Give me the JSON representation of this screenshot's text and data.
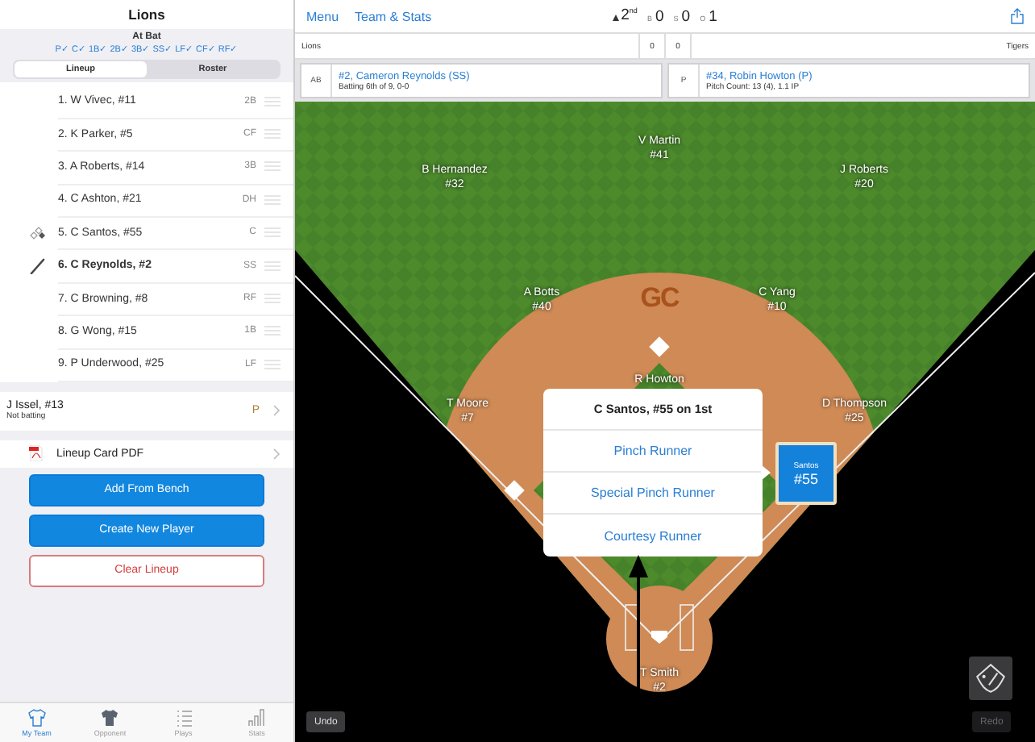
{
  "sidebar": {
    "title": "Lions",
    "at_bat": {
      "heading": "At Bat",
      "positions": "P✓ C✓ 1B✓ 2B✓ 3B✓ SS✓ LF✓ CF✓ RF✓"
    },
    "segments": [
      {
        "label": "Lineup",
        "selected": true
      },
      {
        "label": "Roster",
        "selected": false
      }
    ],
    "lineup": [
      {
        "name": "1. W Vivec, #11",
        "position": "2B",
        "kind": "plain"
      },
      {
        "name": "2. K Parker, #5",
        "position": "CF",
        "kind": "plain"
      },
      {
        "name": "3. A Roberts, #14",
        "position": "3B",
        "kind": "plain"
      },
      {
        "name": "4. C Ashton, #21",
        "position": "DH",
        "kind": "plain"
      },
      {
        "name": "5. C Santos, #55",
        "position": "C",
        "kind": "runner"
      },
      {
        "name": "6. C Reynolds, #2",
        "position": "SS",
        "kind": "batter"
      },
      {
        "name": "7. C Browning, #8",
        "position": "RF",
        "kind": "plain"
      },
      {
        "name": "8. G Wong, #15",
        "position": "1B",
        "kind": "plain"
      },
      {
        "name": "9. P Underwood, #25",
        "position": "LF",
        "kind": "plain"
      }
    ],
    "bench": {
      "name": "J Issel, #13",
      "note": "Not batting",
      "position": "P"
    },
    "pdf": {
      "label": "Lineup Card PDF"
    },
    "buttons": [
      {
        "label": "Add From Bench",
        "kind": "primary"
      },
      {
        "label": "Create New Player",
        "kind": "primary"
      },
      {
        "label": "Clear Lineup",
        "kind": "danger"
      }
    ],
    "tabs": [
      {
        "label": "My Team",
        "kind": "shirt",
        "selected": true
      },
      {
        "label": "Opponent",
        "kind": "jersey",
        "selected": false
      },
      {
        "label": "Plays",
        "kind": "list",
        "selected": false
      },
      {
        "label": "Stats",
        "kind": "bars",
        "selected": false
      }
    ]
  },
  "top_bar": {
    "links": [
      "Menu",
      "Team & Stats"
    ],
    "top_of_inning": true,
    "inning": "2$^{nd}$",
    "count": [
      {
        "label": "B",
        "value": "0"
      },
      {
        "label": "S",
        "value": "0"
      },
      {
        "label": "O",
        "value": "1"
      }
    ]
  },
  "scoreboard": {
    "away": "Lions",
    "away_score": "0",
    "home_score": "0",
    "home": "Tigers"
  },
  "batter": {
    "tag": "AB",
    "name": "#2, Cameron Reynolds (SS)",
    "detail": "Batting 6th of 9, 0-0"
  },
  "pitcher": {
    "tag": "P",
    "name": "#34, Robin Howton (P)",
    "detail": "Pitch Count: 13 (4), 1.1 IP"
  },
  "field": {
    "logo": "GC",
    "players": [
      {
        "kind": "centerfield",
        "name": "V Martin",
        "number": "#41"
      },
      {
        "kind": "leftfield",
        "name": "B Hernandez",
        "number": "#32"
      },
      {
        "kind": "rightfield",
        "name": "J Roberts",
        "number": "#20"
      },
      {
        "kind": "shortstop",
        "name": "A Botts",
        "number": "#40"
      },
      {
        "kind": "second",
        "name": "C Yang",
        "number": "#10"
      },
      {
        "kind": "pitcher",
        "name": "R Howton"
      },
      {
        "kind": "third",
        "name": "T Moore",
        "number": "#7"
      },
      {
        "kind": "first",
        "name": "D Thompson",
        "number": "#25"
      },
      {
        "kind": "catcher",
        "name": "T Smith",
        "number": "#2"
      }
    ],
    "runners": [
      {
        "kind": "first",
        "name": "Santos",
        "number": "#55",
        "selected": true
      }
    ],
    "popup": {
      "title": "C Santos, #55 on 1st",
      "options": [
        "Pinch Runner",
        "Special Pinch Runner",
        "Courtesy Runner"
      ]
    },
    "undo": {
      "label": "Undo",
      "disabled": false
    },
    "redo": {
      "label": "Redo",
      "disabled": true
    }
  }
}
